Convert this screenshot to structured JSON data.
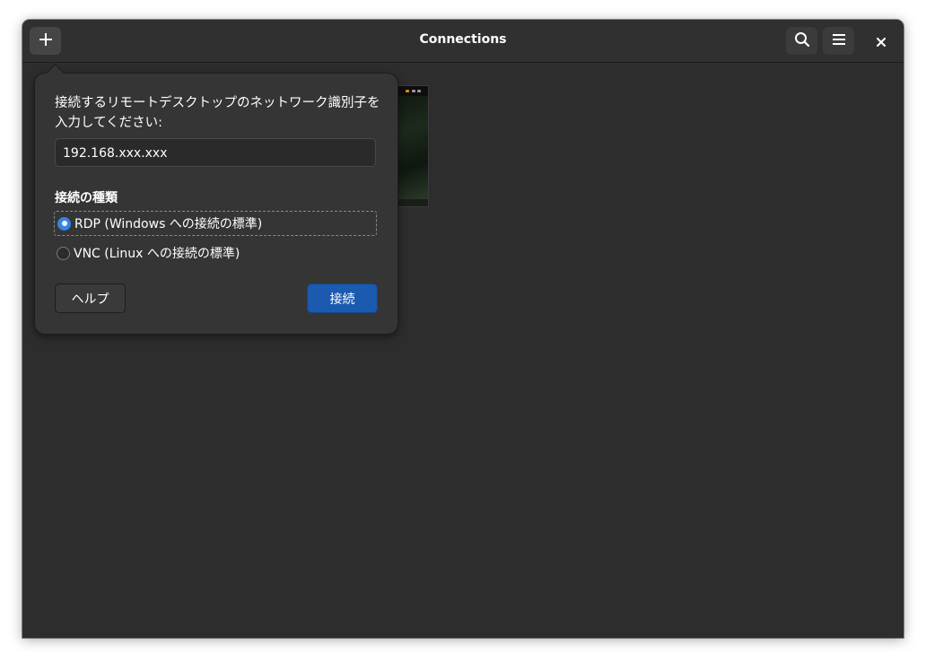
{
  "window": {
    "title": "Connections"
  },
  "header": {
    "add_icon": "plus-icon",
    "search_icon": "search-icon",
    "menu_icon": "hamburger-menu-icon",
    "close_icon": "close-icon"
  },
  "popover": {
    "prompt": "接続するリモートデスクトップのネットワーク識別子を入力してください:",
    "address_value": "192.168.xxx.xxx",
    "connection_type_label": "接続の種類",
    "options": [
      {
        "label": "RDP (Windows への接続の標準)",
        "selected": true
      },
      {
        "label": "VNC (Linux への接続の標準)",
        "selected": false
      }
    ],
    "help_label": "ヘルプ",
    "connect_label": "接続"
  },
  "colors": {
    "window_bg": "#2d2d2d",
    "popover_bg": "#353535",
    "accent": "#1c5ab0",
    "radio_selected": "#3584e4"
  }
}
